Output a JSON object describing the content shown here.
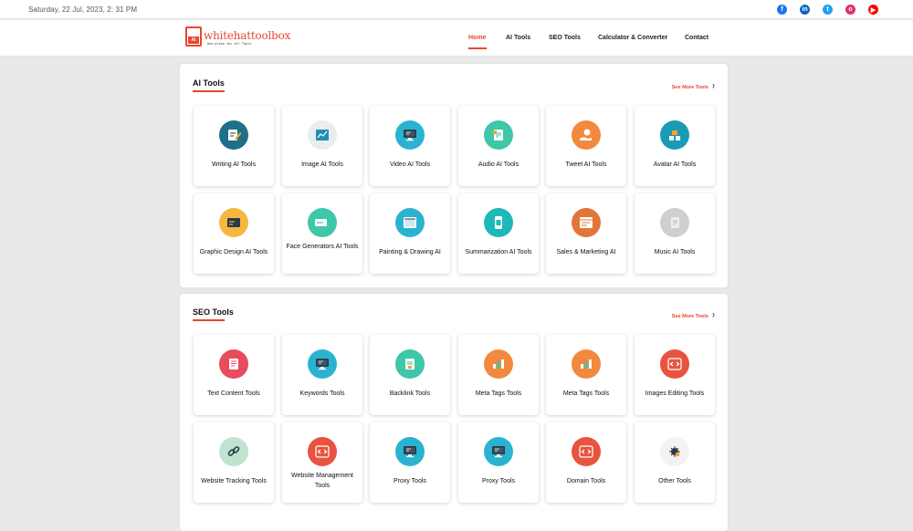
{
  "topbar": {
    "datetime": "Saturday, 22 Jul, 2023, 2: 31 PM",
    "social": [
      {
        "icon": "facebook-icon",
        "color": "#1877f2",
        "glyph": "f"
      },
      {
        "icon": "linkedin-icon",
        "color": "#0a66c2",
        "glyph": "in"
      },
      {
        "icon": "twitter-icon",
        "color": "#1da1f2",
        "glyph": "t"
      },
      {
        "icon": "instagram-icon",
        "color": "#e1306c",
        "glyph": "o"
      },
      {
        "icon": "youtube-icon",
        "color": "#ff0000",
        "glyph": "▶"
      }
    ]
  },
  "header": {
    "logo_text": "whitehattoolbox",
    "logo_mark": "AI",
    "logo_tagline": "One place for all Tools",
    "nav": [
      "Home",
      "AI Tools",
      "SEO Tools",
      "Calculator & Converter",
      "Contact"
    ],
    "active_nav": "Home"
  },
  "colors": {
    "accent": "#e8472f"
  },
  "ai_section": {
    "title": "AI Tools",
    "see_more": "See More Tools",
    "cards": [
      {
        "label": "Writing AI Tools",
        "icon": "writing-icon",
        "color": "#1f6f8b"
      },
      {
        "label": "Image AI Tools",
        "icon": "image-chart-icon",
        "color": "#e8edf2"
      },
      {
        "label": "Video AI Tools",
        "icon": "monitor-icon",
        "color": "#2ab3d1"
      },
      {
        "label": "Audio AI Tools",
        "icon": "audio-doc-icon",
        "color": "#3ec7a8"
      },
      {
        "label": "Tweet AI Tools",
        "icon": "tweet-hand-icon",
        "color": "#f2893f"
      },
      {
        "label": "Avatar AI Tools",
        "icon": "avatar-blocks-icon",
        "color": "#1a9bb5"
      },
      {
        "label": "Graphic Design AI Tools",
        "icon": "design-board-icon",
        "color": "#f5b83d"
      },
      {
        "label": "Face Generators AI Tools",
        "icon": "face-card-icon",
        "color": "#3ec7a8"
      },
      {
        "label": "Painting & Drawing AI",
        "icon": "canvas-icon",
        "color": "#2ab3d1"
      },
      {
        "label": "Summarization AI Tools",
        "icon": "phone-doc-icon",
        "color": "#1fb8b8"
      },
      {
        "label": "Sales & Marketing AI",
        "icon": "browser-window-icon",
        "color": "#e2763a"
      },
      {
        "label": "Music AI Tools",
        "icon": "music-doc-icon",
        "color": "#cfcfcf"
      }
    ]
  },
  "seo_section": {
    "title": "SEO Tools",
    "see_more": "See More Tools",
    "cards": [
      {
        "label": "Text Content Tools",
        "icon": "text-doc-icon",
        "color": "#e84b5c"
      },
      {
        "label": "Keywords Tools",
        "icon": "monitor-icon",
        "color": "#2ab3d1"
      },
      {
        "label": "Backlink Tools",
        "icon": "backlink-doc-icon",
        "color": "#3ec7a8"
      },
      {
        "label": "Meta Tags Tools",
        "icon": "meta-chart-icon",
        "color": "#f2893f"
      },
      {
        "label": "Meta Tags Tools",
        "icon": "meta-chart-icon",
        "color": "#f2893f"
      },
      {
        "label": "Images Editing Tools",
        "icon": "code-icon",
        "color": "#e8533e"
      },
      {
        "label": "Website Tracking Tools",
        "icon": "chain-link-icon",
        "color": "#bfe3cf"
      },
      {
        "label": "Website Management Tools",
        "icon": "code-icon",
        "color": "#e8533e"
      },
      {
        "label": "Proxy Tools",
        "icon": "monitor-icon",
        "color": "#2ab3d1"
      },
      {
        "label": "Proxy Tools",
        "icon": "monitor-icon",
        "color": "#2ab3d1"
      },
      {
        "label": "Domain Tools",
        "icon": "code-icon",
        "color": "#e8533e"
      },
      {
        "label": "Other Tools",
        "icon": "bug-gear-icon",
        "color": "#f3f3f3"
      }
    ]
  }
}
